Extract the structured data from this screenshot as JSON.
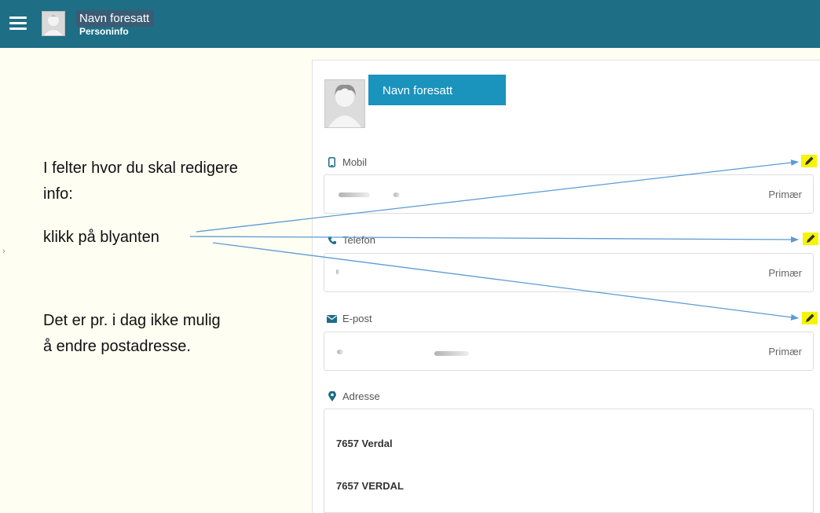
{
  "header": {
    "title": "Navn foresatt",
    "subtitle": "Personinfo",
    "menu_icon": "hamburger-menu-icon",
    "avatar_icon": "user-avatar-icon"
  },
  "instructions": {
    "line_1": "I felter hvor du skal redigere info:",
    "line_2": "klikk på blyanten",
    "line_3": "Det er pr. i dag ikke mulig å endre postadresse."
  },
  "profile": {
    "name": "Navn foresatt",
    "avatar_icon": "user-avatar-icon"
  },
  "fields": {
    "mobile": {
      "label": "Mobil",
      "icon": "mobile-phone-icon",
      "tag": "Primær",
      "edit_icon": "pencil-icon"
    },
    "phone": {
      "label": "Telefon",
      "icon": "phone-icon",
      "tag": "Primær",
      "edit_icon": "pencil-icon"
    },
    "email": {
      "label": "E-post",
      "icon": "envelope-icon",
      "tag": "Primær",
      "edit_icon": "pencil-icon"
    },
    "address": {
      "label": "Adresse",
      "icon": "map-marker-icon",
      "line_1": "7657 Verdal",
      "line_2": "7657 VERDAL"
    }
  },
  "colors": {
    "header_bg": "#1e6e86",
    "banner_bg": "#1a93bd",
    "highlight": "#f5f500",
    "arrow": "#5b9bd5",
    "page_bg": "#fefef3"
  }
}
